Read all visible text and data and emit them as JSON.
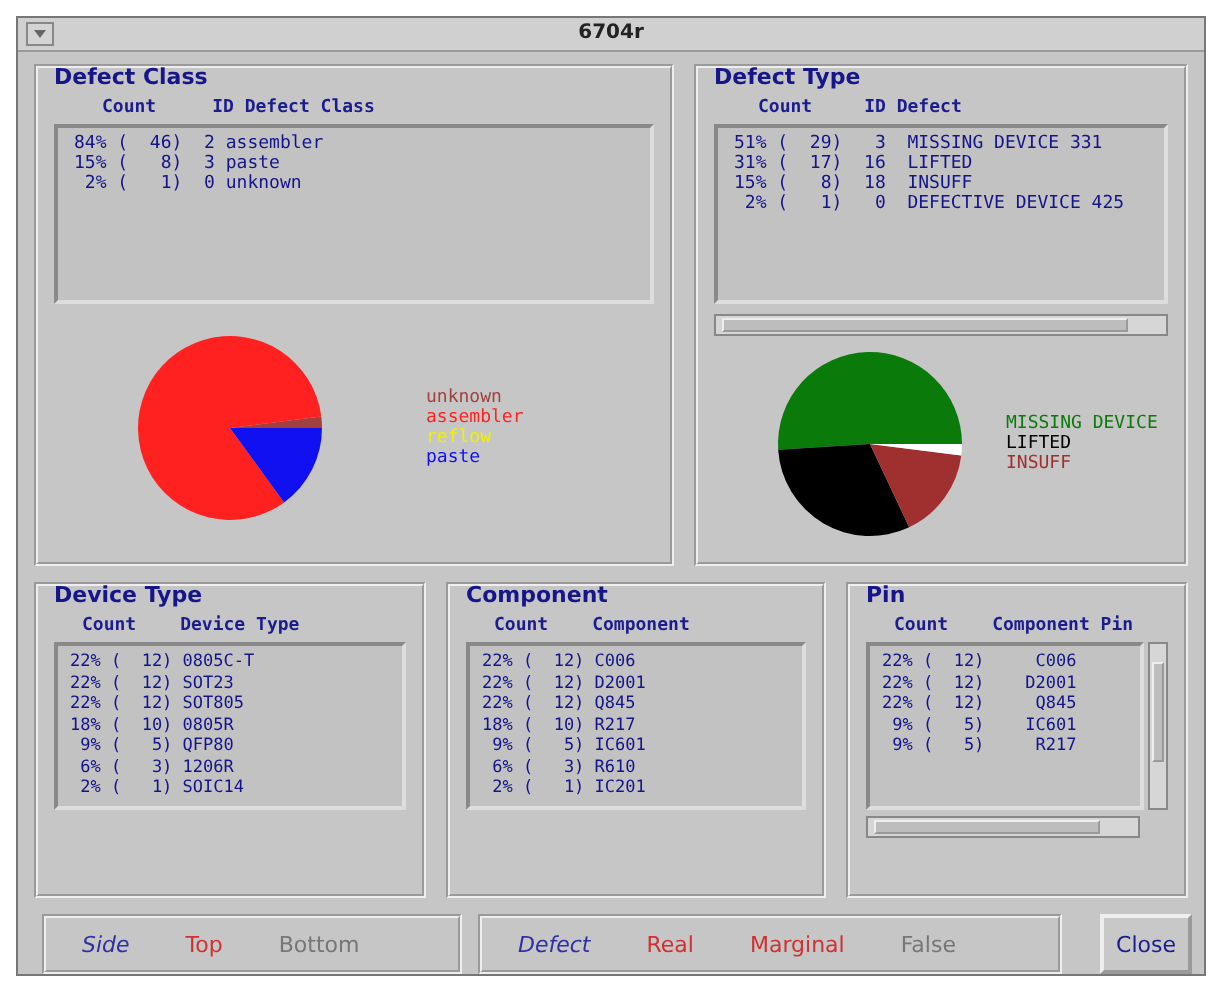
{
  "window": {
    "title": "6704r"
  },
  "top_panels": [
    {
      "title": "Defect Class",
      "columns": [
        "Count",
        "ID Defect Class"
      ],
      "rows": [
        "84% (  46)  2 assembler",
        "15% (   8)  3 paste",
        " 2% (   1)  0 unknown"
      ],
      "hscroll": false,
      "legend": [
        {
          "label": "unknown",
          "color": "#a04040"
        },
        {
          "label": "assembler",
          "color": "#ff2020"
        },
        {
          "label": "reflow",
          "color": "#f0f000"
        },
        {
          "label": "paste",
          "color": "#1010f0"
        }
      ],
      "chart_data": {
        "type": "pie",
        "values": [
          2,
          83,
          0,
          15
        ]
      }
    },
    {
      "title": "Defect Type",
      "columns": [
        "Count",
        "ID Defect"
      ],
      "rows": [
        "51% (  29)   3  MISSING DEVICE 331",
        "31% (  17)  16  LIFTED",
        "15% (   8)  18  INSUFF",
        " 2% (   1)   0  DEFECTIVE DEVICE 425"
      ],
      "hscroll": true,
      "legend": [
        {
          "label": "MISSING DEVICE",
          "color": "#0a7a0a"
        },
        {
          "label": "LIFTED",
          "color": "#000000"
        },
        {
          "label": "INSUFF",
          "color": "#a03030"
        }
      ],
      "chart_data": {
        "type": "pie",
        "values": [
          51,
          31,
          16,
          2
        ]
      }
    }
  ],
  "bottom_panels": [
    {
      "title": "Device Type",
      "columns": [
        "Count",
        "Device Type"
      ],
      "rows": [
        "22% (  12) 0805C-T",
        "22% (  12) SOT23",
        "22% (  12) SOT805",
        "18% (  10) 0805R",
        " 9% (   5) QFP80",
        " 6% (   3) 1206R",
        " 2% (   1) SOIC14"
      ],
      "scroll": false
    },
    {
      "title": "Component",
      "columns": [
        "Count",
        "Component"
      ],
      "rows": [
        "22% (  12) C006",
        "22% (  12) D2001",
        "22% (  12) Q845",
        "18% (  10) R217",
        " 9% (   5) IC601",
        " 6% (   3) R610",
        " 2% (   1) IC201"
      ],
      "scroll": false
    },
    {
      "title": "Pin",
      "columns": [
        "Count",
        "Component Pin"
      ],
      "rows": [
        "22% (  12)     C006",
        "22% (  12)    D2001",
        "22% (  12)     Q845",
        " 9% (   5)    IC601",
        " 9% (   5)     R217"
      ],
      "scroll": true
    }
  ],
  "filters": [
    {
      "label": "Side",
      "options": [
        {
          "label": "Top",
          "selected": true
        },
        {
          "label": "Bottom",
          "selected": false
        }
      ]
    },
    {
      "label": "Defect",
      "options": [
        {
          "label": "Real",
          "selected": true
        },
        {
          "label": "Marginal",
          "selected": true
        },
        {
          "label": "False",
          "selected": false
        }
      ]
    }
  ],
  "close_button": "Close"
}
